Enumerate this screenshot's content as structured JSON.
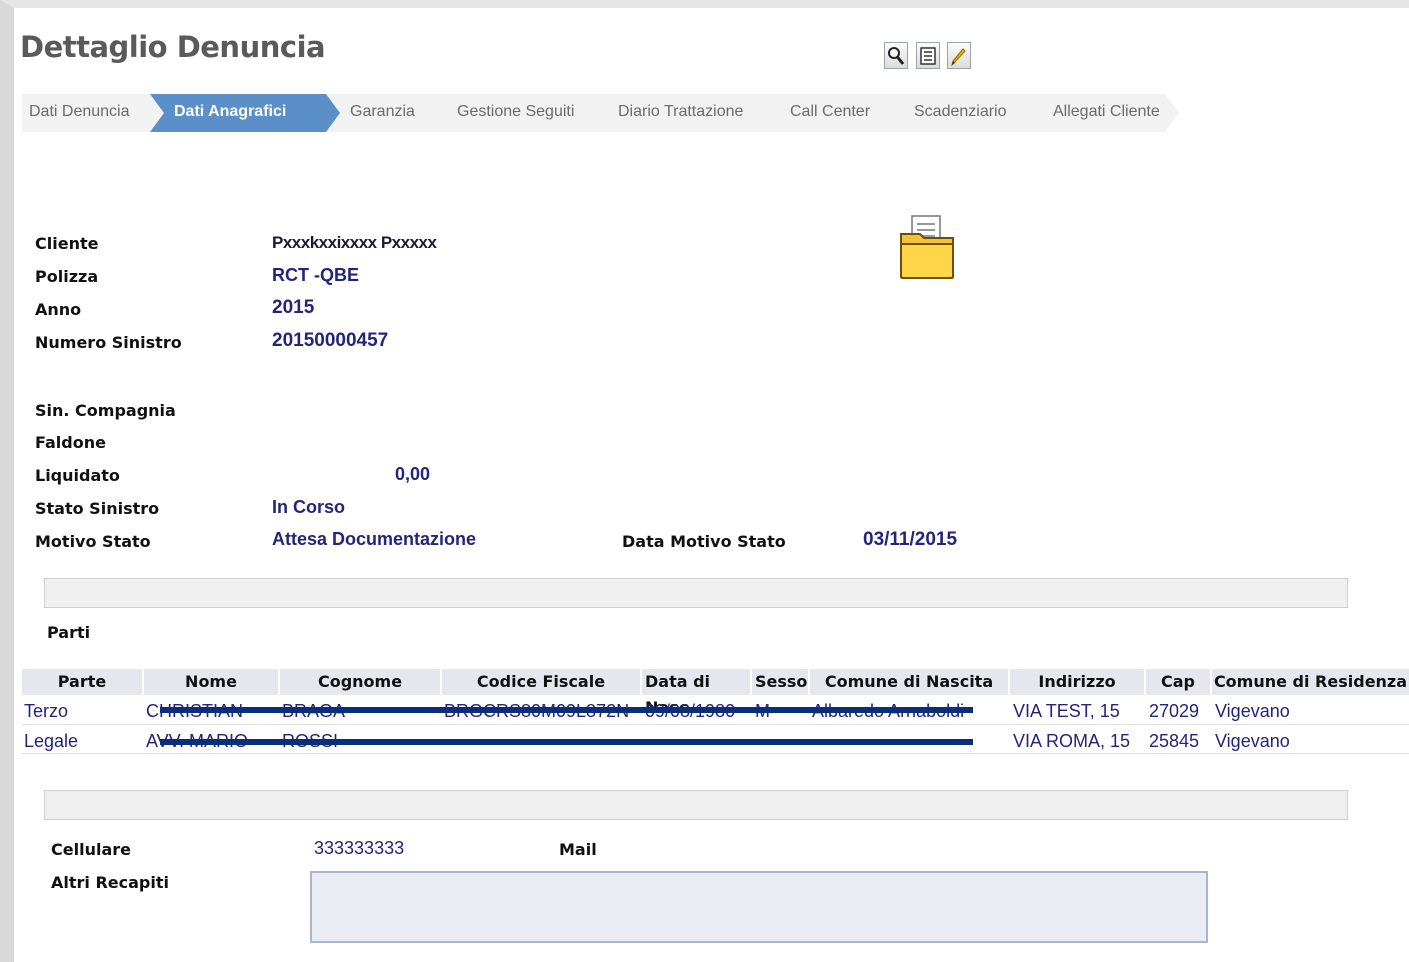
{
  "page": {
    "title": "Dettaglio Denuncia"
  },
  "toolbar": {
    "icons": [
      "search-icon",
      "list-icon",
      "edit-pencil-icon"
    ]
  },
  "tabs": [
    {
      "label": "Dati Denuncia",
      "active": false
    },
    {
      "label": "Dati Anagrafici",
      "active": true
    },
    {
      "label": "Garanzia",
      "active": false
    },
    {
      "label": "Gestione Seguiti",
      "active": false
    },
    {
      "label": "Diario Trattazione",
      "active": false
    },
    {
      "label": "Call Center",
      "active": false
    },
    {
      "label": "Scadenziario",
      "active": false
    },
    {
      "label": "Allegati Cliente",
      "active": false
    }
  ],
  "claim": {
    "cliente_label": "Cliente",
    "cliente_value": "Pxxxkxxixxxx Pxxxxx",
    "polizza_label": "Polizza",
    "polizza_value": "RCT -QBE",
    "anno_label": "Anno",
    "anno_value": "2015",
    "numero_label": "Numero Sinistro",
    "numero_value": "20150000457",
    "sin_compagnia_label": "Sin. Compagnia",
    "faldone_label": "Faldone",
    "liquidato_label": "Liquidato",
    "liquidato_value": "0,00",
    "stato_label": "Stato Sinistro",
    "stato_value": "In Corso",
    "motivo_label": "Motivo Stato",
    "motivo_value": "Attesa Documentazione",
    "data_motivo_label": "Data Motivo Stato",
    "data_motivo_value": "03/11/2015"
  },
  "parti": {
    "title": "Parti",
    "columns": [
      "Parte",
      "Nome",
      "Cognome",
      "Codice Fiscale",
      "Data di Nasc",
      "Sesso",
      "Comune di Nascita",
      "Indirizzo",
      "Cap",
      "Comune di Residenza"
    ],
    "rows": [
      [
        "Terzo",
        "CHRISTIAN",
        "BRAGA",
        "BRGCRS80M09L872N",
        "09/08/1980",
        "M",
        "Albaredo Arnaboldi",
        "VIA TEST, 15",
        "27029",
        "Vigevano"
      ],
      [
        "Legale",
        "AVV. MARIO",
        "ROSSI",
        "",
        "",
        "",
        "",
        "VIA ROMA, 15",
        "25845",
        "Vigevano"
      ]
    ]
  },
  "contatti": {
    "cellulare_label": "Cellulare",
    "cellulare_value": "333333333",
    "mail_label": "Mail",
    "altri_label": "Altri Recapiti"
  },
  "colors": {
    "accent_tab": "#5b8fc7",
    "value_text": "#24247a",
    "redaction": "#0b2d7a"
  }
}
